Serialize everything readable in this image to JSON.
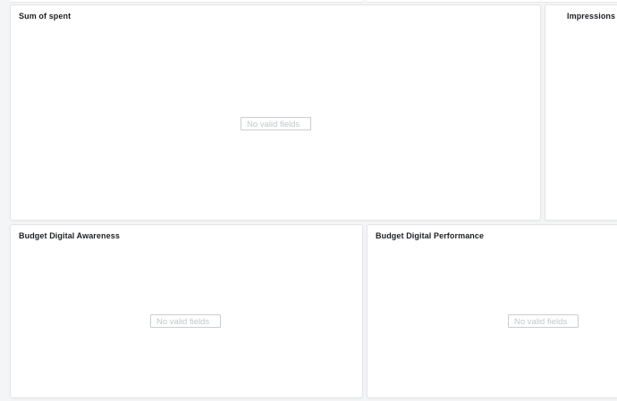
{
  "panels": {
    "sum_of_spent": {
      "title": "Sum of spent",
      "empty_message": "No valid fields"
    },
    "impressions": {
      "title": "Impressions p/v"
    },
    "budget_digital_awareness": {
      "title": "Budget Digital Awareness",
      "empty_message": "No valid fields"
    },
    "budget_digital_performance": {
      "title": "Budget Digital Performance",
      "empty_message": "No valid fields"
    }
  }
}
